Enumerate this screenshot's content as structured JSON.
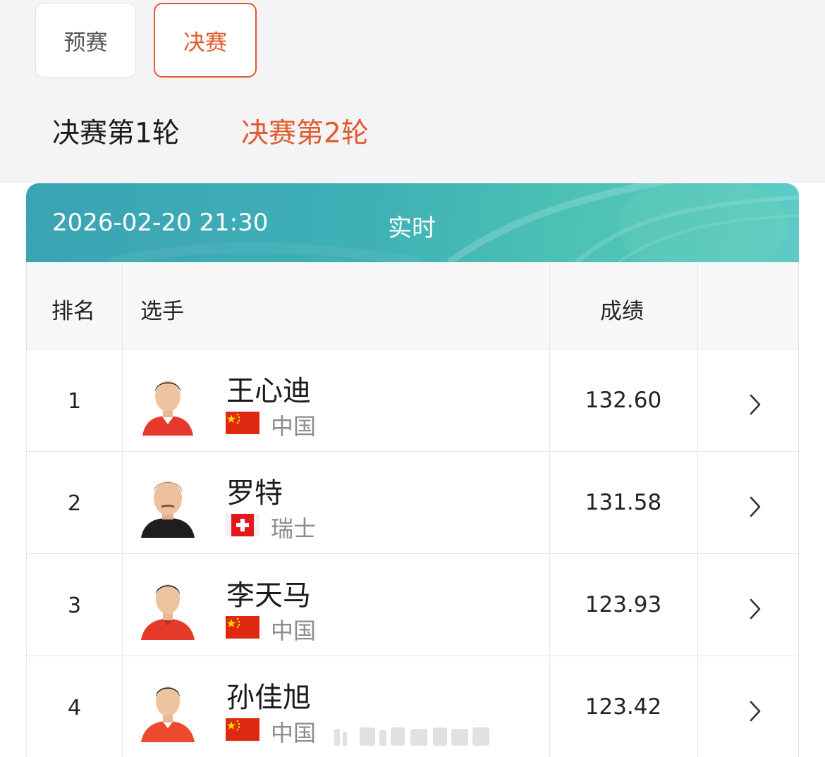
{
  "stage_tabs": {
    "prelim": "预赛",
    "final": "决赛"
  },
  "round_tabs": {
    "r1": "决赛第1轮",
    "r2": "决赛第2轮"
  },
  "banner": {
    "time": "2026-02-20 21:30",
    "status": "实时"
  },
  "table": {
    "headers": {
      "rank": "排名",
      "player": "选手",
      "score": "成绩"
    },
    "rows": [
      {
        "rank": "1",
        "name": "王心迪",
        "country": "中国",
        "flag": "china-flag",
        "score": "132.60"
      },
      {
        "rank": "2",
        "name": "罗特",
        "country": "瑞士",
        "flag": "switzerland-flag",
        "score": "131.58"
      },
      {
        "rank": "3",
        "name": "李天马",
        "country": "中国",
        "flag": "china-flag",
        "score": "123.93"
      },
      {
        "rank": "4",
        "name": "孙佳旭",
        "country": "中国",
        "flag": "china-flag",
        "score": "123.42"
      }
    ]
  },
  "colors": {
    "accent": "#e05a2b",
    "banner": "#3fb1b6",
    "header_bg": "#f7f7f8",
    "top_bg": "#f4f4f6"
  }
}
